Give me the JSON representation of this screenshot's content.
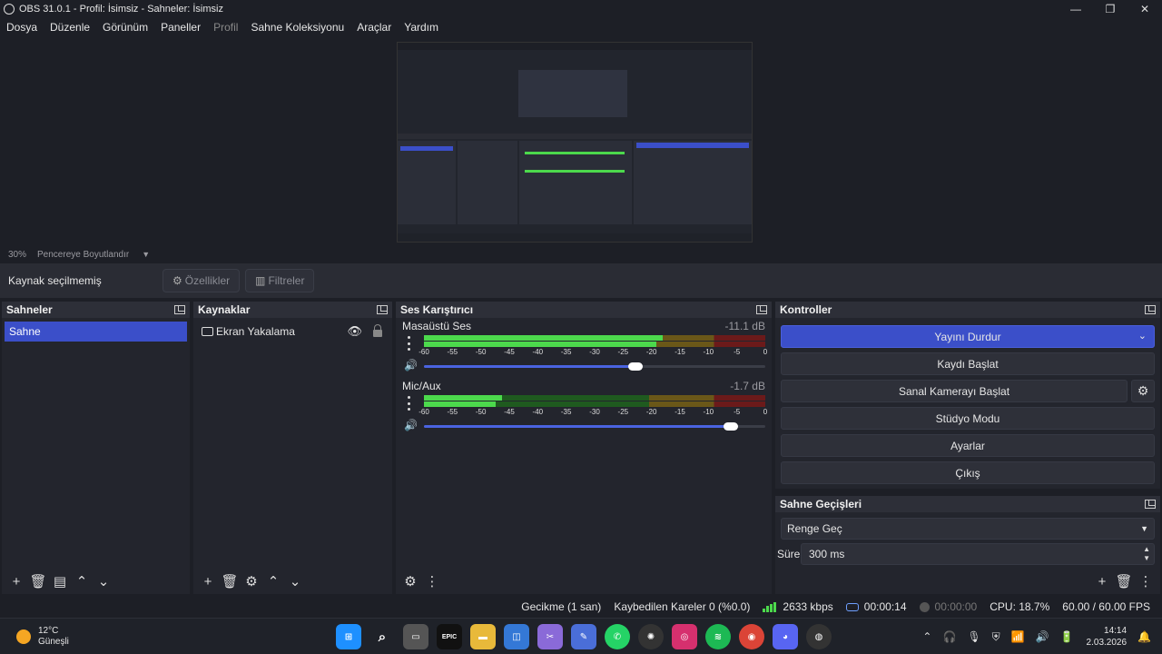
{
  "window": {
    "title": "OBS 31.0.1 - Profil: İsimsiz - Sahneler: İsimsiz",
    "controls": [
      "—",
      "❐",
      "✕"
    ]
  },
  "menu": {
    "items": [
      "Dosya",
      "Düzenle",
      "Görünüm",
      "Paneller",
      "Profil",
      "Sahne Koleksiyonu",
      "Araçlar",
      "Yardım"
    ]
  },
  "preview": {
    "zoom": "30%",
    "fit_label": "Pencereye Boyutlandır"
  },
  "source_toolbar": {
    "no_source": "Kaynak seçilmemiş",
    "properties": "Özellikler",
    "filters": "Filtreler"
  },
  "scenes": {
    "title": "Sahneler",
    "items": [
      "Sahne"
    ]
  },
  "sources": {
    "title": "Kaynaklar",
    "items": [
      "Ekran Yakalama"
    ]
  },
  "mixer": {
    "title": "Ses Karıştırıcı",
    "scale": [
      "-60",
      "-55",
      "-50",
      "-45",
      "-40",
      "-35",
      "-30",
      "-25",
      "-20",
      "-15",
      "-10",
      "-5",
      "0"
    ],
    "channels": [
      {
        "name": "Masaüstü Ses",
        "db": "-11.1 dB",
        "level_fraction": 0.7,
        "volume_fraction": 0.62
      },
      {
        "name": "Mic/Aux",
        "db": "-1.7 dB",
        "level_fraction": 0.23,
        "volume_fraction": 0.9
      }
    ]
  },
  "controls": {
    "title": "Kontroller",
    "stop_stream": "Yayını Durdur",
    "start_record": "Kaydı Başlat",
    "virtual_cam": "Sanal Kamerayı Başlat",
    "studio_mode": "Stüdyo Modu",
    "settings": "Ayarlar",
    "exit": "Çıkış"
  },
  "transitions": {
    "title": "Sahne Geçişleri",
    "selected": "Renge Geç",
    "duration_label": "Süre",
    "duration_value": "300 ms"
  },
  "status": {
    "delay": "Gecikme (1 san)",
    "dropped": "Kaybedilen Kareler 0 (%0.0)",
    "bitrate": "2633 kbps",
    "stream_time": "00:00:14",
    "record_time": "00:00:00",
    "cpu": "CPU: 18.7%",
    "fps": "60.00 / 60.00 FPS"
  },
  "taskbar": {
    "temp": "12°C",
    "weather": "Güneşli",
    "time": "14:14",
    "date": "2.03.2026",
    "epic_label": "EPIC"
  },
  "colors": {
    "accent": "#3b4fc9",
    "meter_green": "#4cd94c"
  }
}
